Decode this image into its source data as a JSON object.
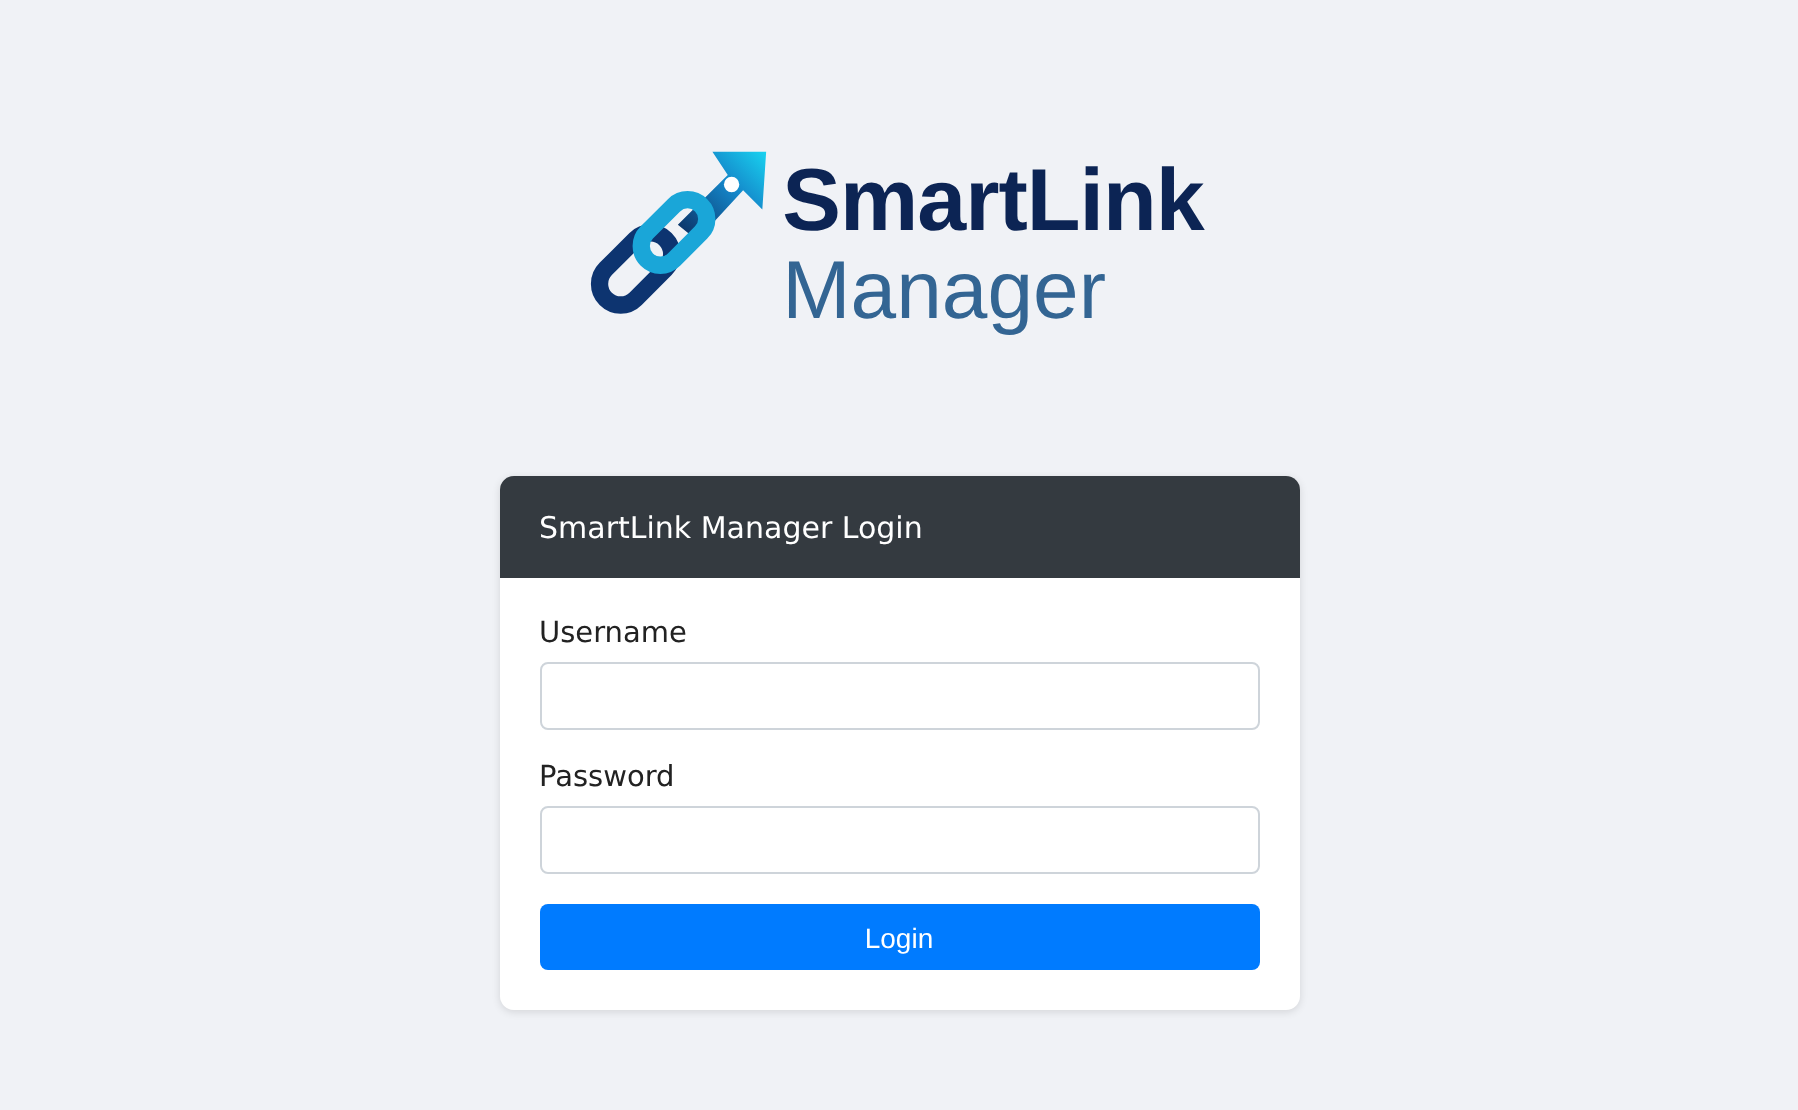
{
  "logo": {
    "line_1": "SmartLink",
    "line_2": "Manager"
  },
  "login_card": {
    "title": "SmartLink Manager Login",
    "fields": [
      {
        "label": "Username"
      },
      {
        "label": "Password"
      }
    ],
    "button": "Login"
  }
}
